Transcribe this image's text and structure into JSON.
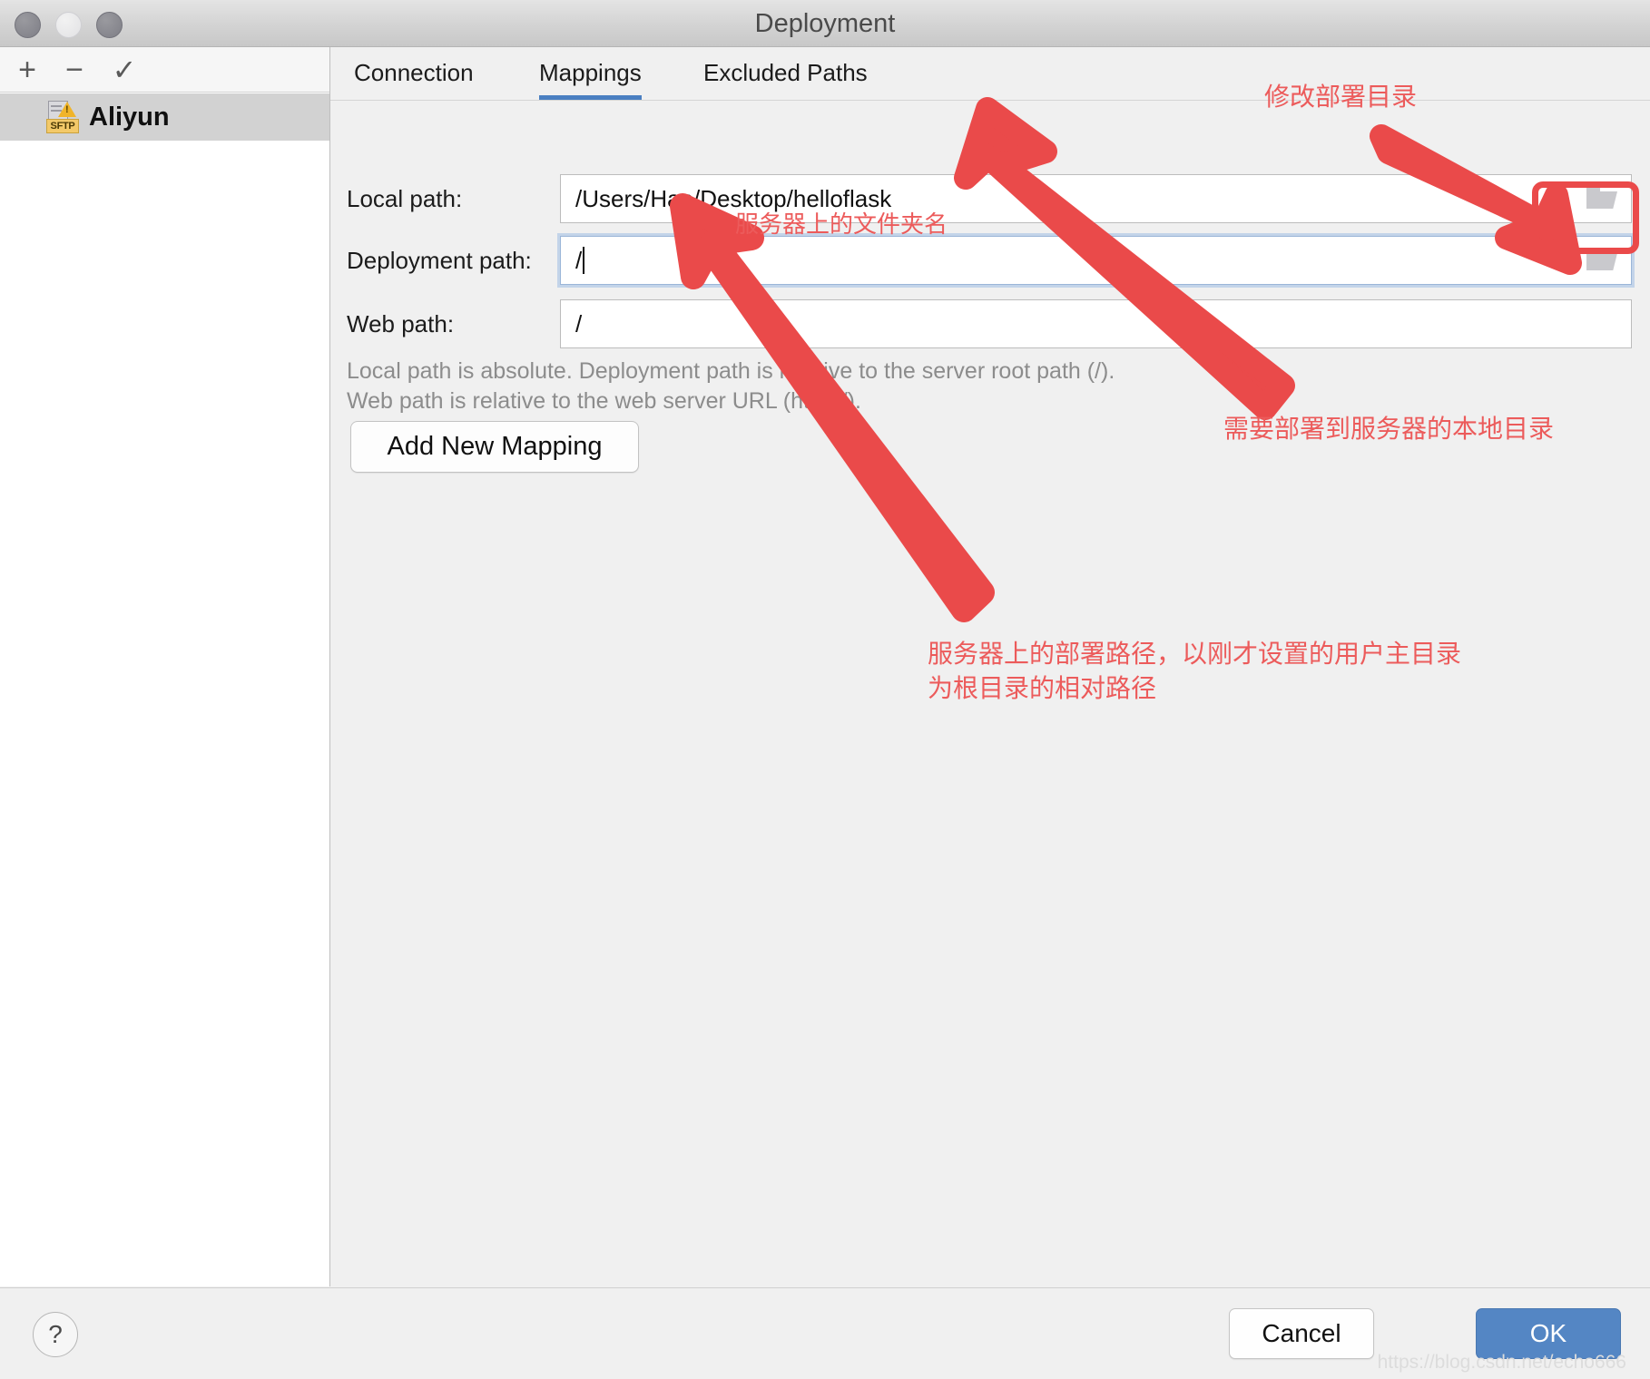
{
  "window": {
    "title": "Deployment",
    "traffic_lights": [
      "close",
      "minimize",
      "zoom"
    ]
  },
  "sidebar": {
    "toolbar": {
      "add_label": "+",
      "remove_label": "−",
      "check_label": "✓"
    },
    "items": [
      {
        "label": "Aliyun",
        "icon": "sftp-icon",
        "badge": "SFTP",
        "selected": true
      }
    ]
  },
  "main": {
    "tabs": [
      {
        "label": "Connection",
        "active": false
      },
      {
        "label": "Mappings",
        "active": true
      },
      {
        "label": "Excluded Paths",
        "active": false
      }
    ],
    "fields": [
      {
        "label": "Local path:",
        "value": "/Users/Hao/Desktop/helloflask",
        "focused": false,
        "browse_icon": "folder-icon"
      },
      {
        "label": "Deployment path:",
        "value": "/",
        "focused": true,
        "browse_icon": "folder-icon"
      },
      {
        "label": "Web path:",
        "value": "/",
        "focused": false,
        "browse_icon": ""
      }
    ],
    "hint_line_1": "Local path is absolute. Deployment path is relative to the server root path (/).",
    "hint_line_2": "Web path is relative to the web server URL (http://).",
    "add_mapping_label": "Add New Mapping"
  },
  "annotations": {
    "accent_color": "#ec5b5b",
    "top_right": "修改部署目录",
    "deployment_inline": "服务器上的文件夹名",
    "right_middle": "需要部署到服务器的本地目录",
    "bottom": "服务器上的部署路径，以刚才设置的用户主目录\n为根目录的相对路径"
  },
  "footer": {
    "help_label": "?",
    "cancel_label": "Cancel",
    "ok_label": "OK",
    "ok_color": "#5486c4",
    "watermark": "https://blog.csdn.net/echo666"
  }
}
